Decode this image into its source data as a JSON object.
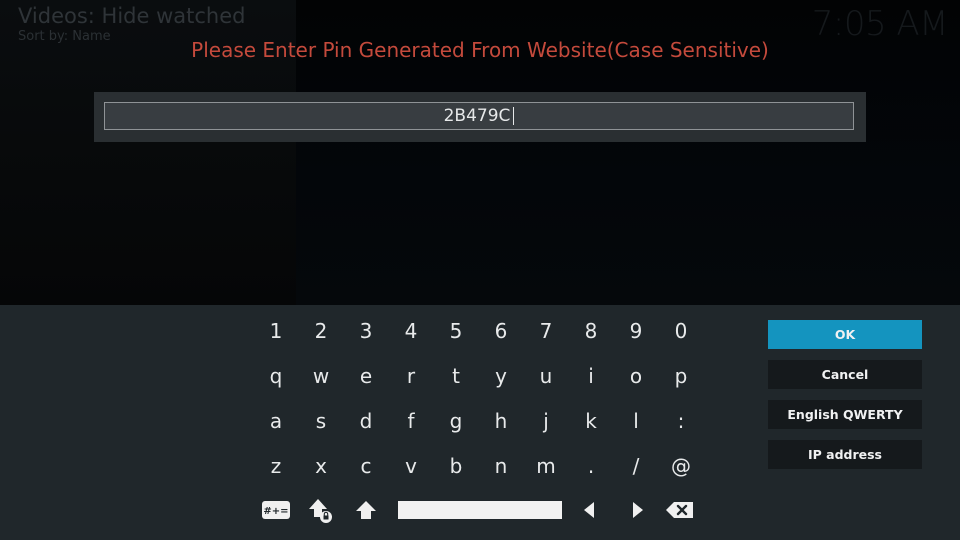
{
  "header": {
    "title": "Videos: Hide watched",
    "sort": "Sort by: Name",
    "clock": "7:05 AM"
  },
  "dialog": {
    "prompt": "Please Enter Pin Generated From Website(Case Sensitive)",
    "input_value": "2B479C"
  },
  "keyboard": {
    "rows": [
      [
        "1",
        "2",
        "3",
        "4",
        "5",
        "6",
        "7",
        "8",
        "9",
        "0"
      ],
      [
        "q",
        "w",
        "e",
        "r",
        "t",
        "y",
        "u",
        "i",
        "o",
        "p"
      ],
      [
        "a",
        "s",
        "d",
        "f",
        "g",
        "h",
        "j",
        "k",
        "l",
        ":"
      ],
      [
        "z",
        "x",
        "c",
        "v",
        "b",
        "n",
        "m",
        ".",
        "/",
        "@"
      ]
    ],
    "symbols_label": "#+=",
    "icons": [
      "shift-lock-icon",
      "shift-icon",
      "space-bar",
      "arrow-left-icon",
      "arrow-right-icon",
      "backspace-icon"
    ]
  },
  "buttons": {
    "ok": "OK",
    "cancel": "Cancel",
    "layout": "English QWERTY",
    "ip": "IP address"
  },
  "colors": {
    "prompt": "#c44a3c",
    "ok_accent": "#1494bf",
    "keyboard_bg": "#20272b"
  }
}
